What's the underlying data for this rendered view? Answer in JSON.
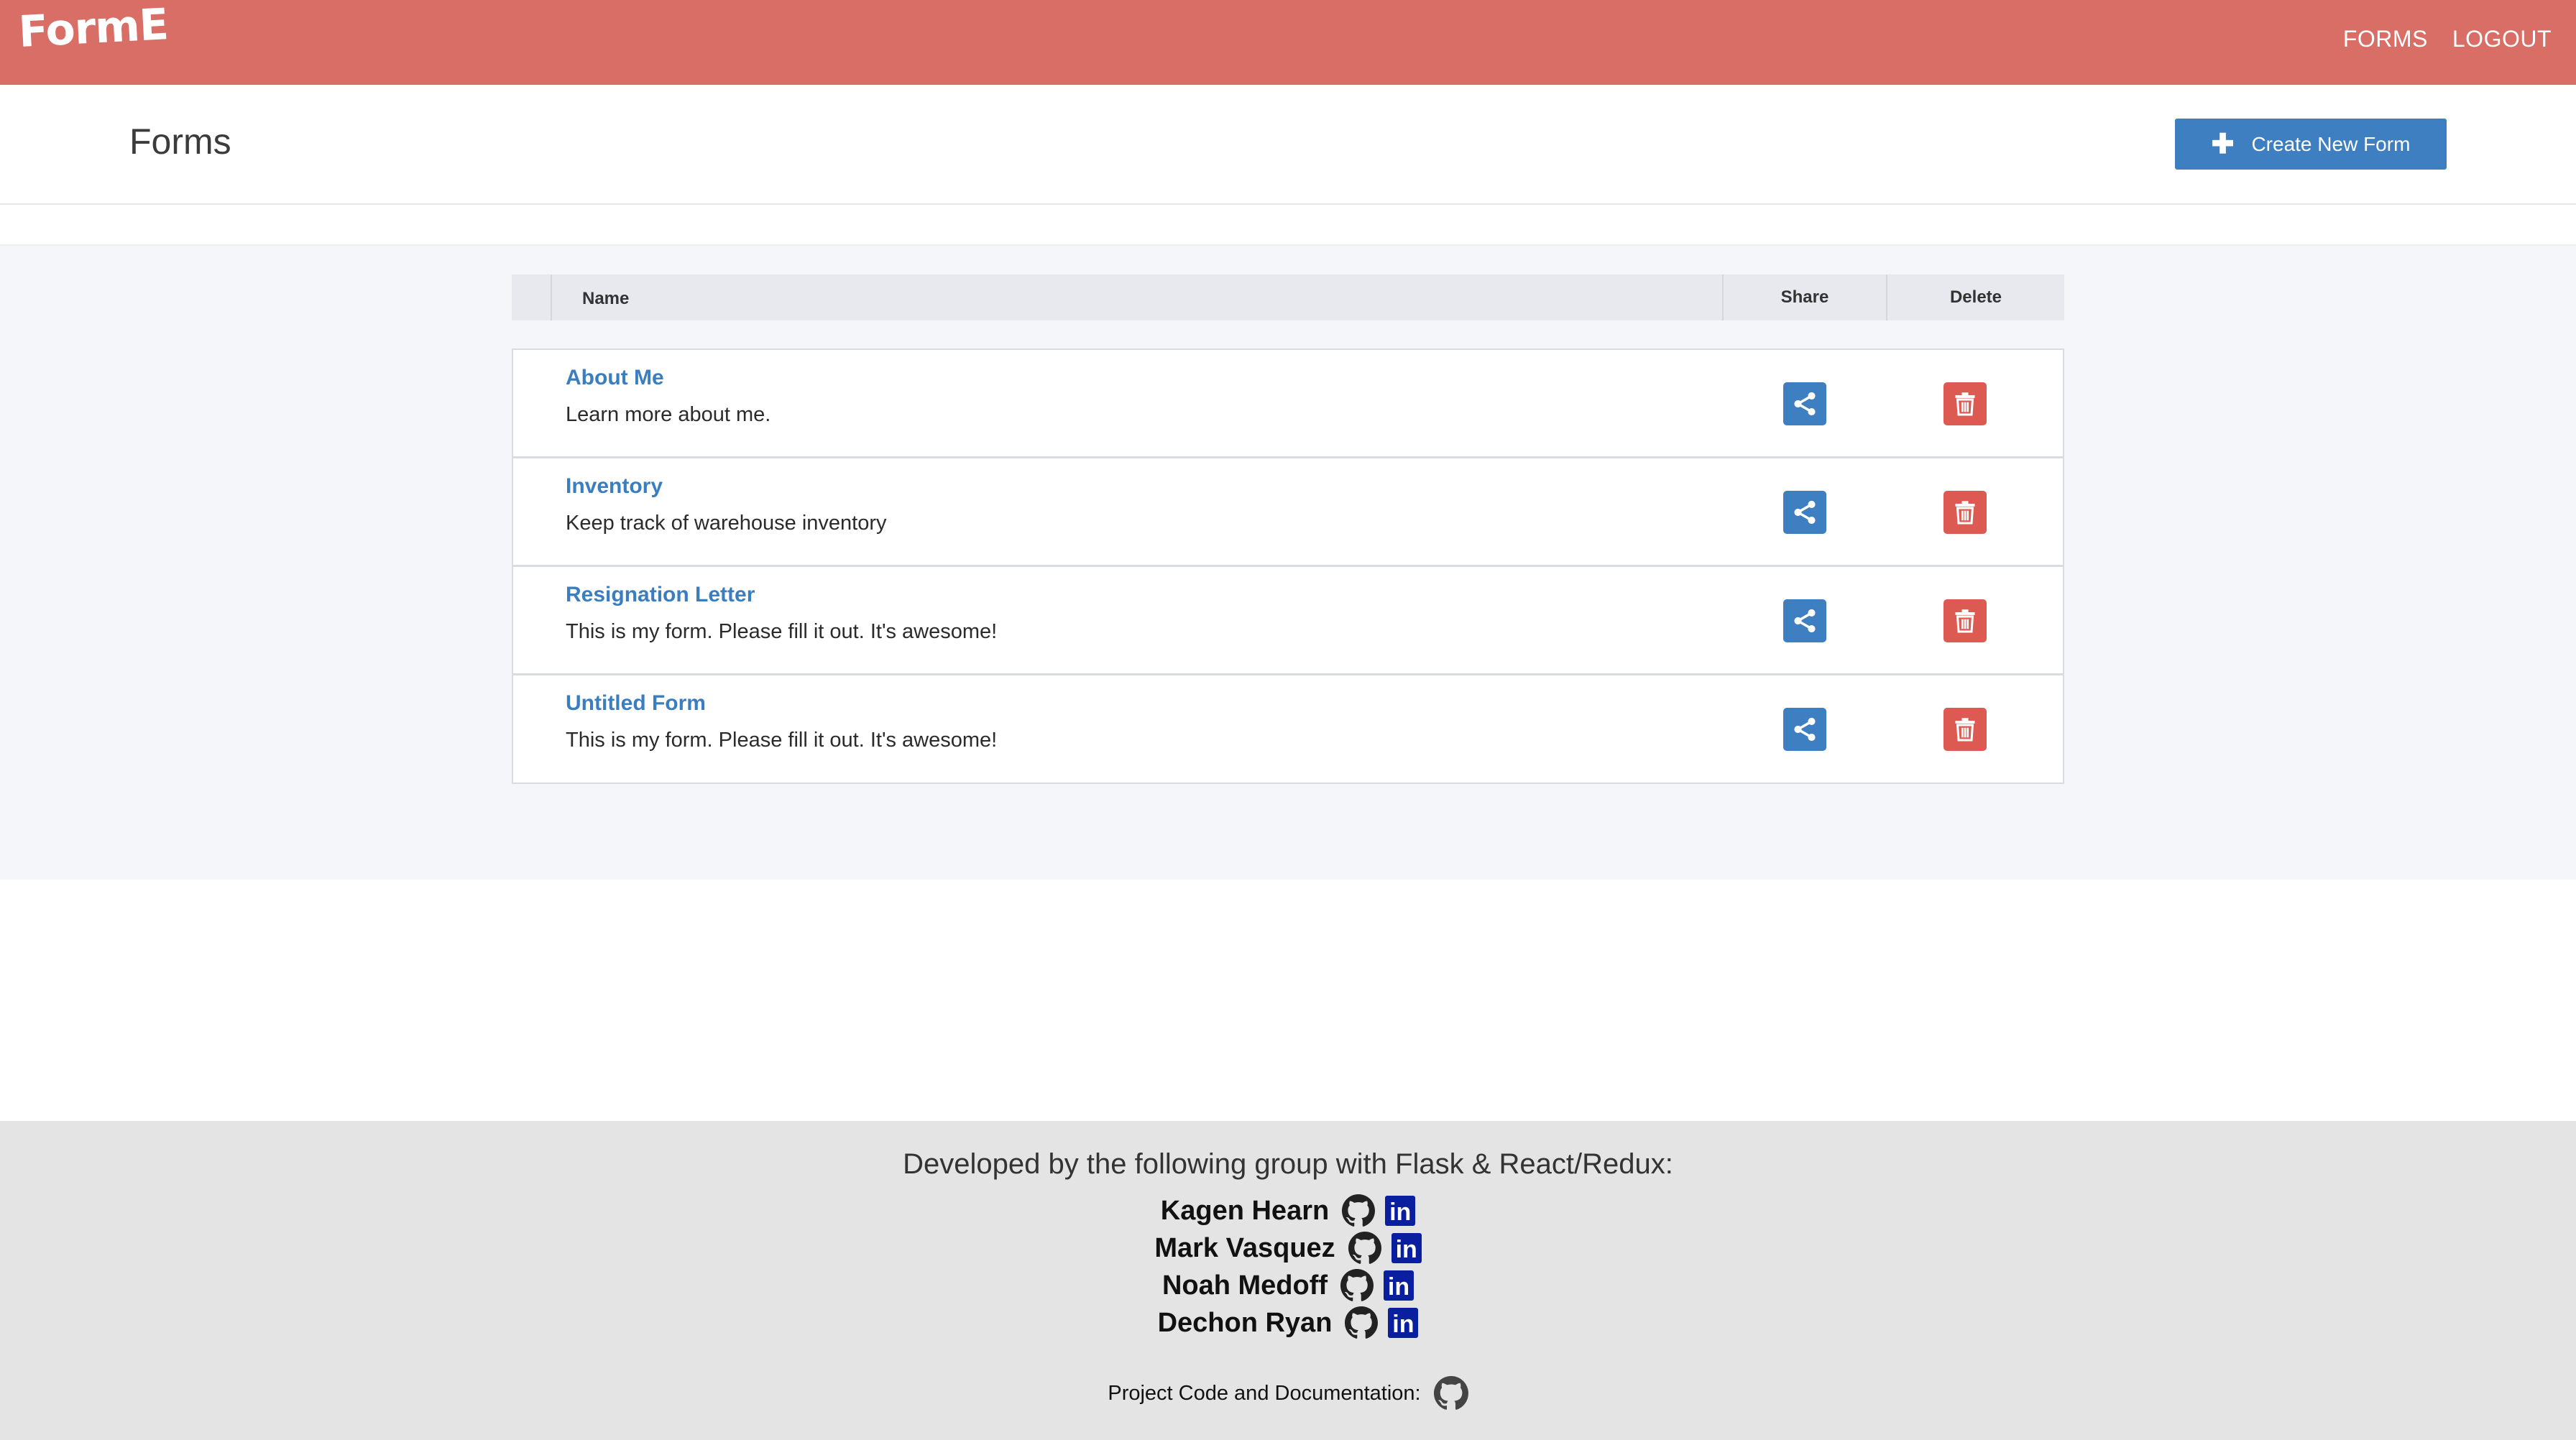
{
  "navbar": {
    "logo": "FormE",
    "links": [
      "FORMS",
      "LOGOUT"
    ]
  },
  "header": {
    "title": "Forms",
    "create_label": "Create New Form"
  },
  "table": {
    "columns": [
      "Name",
      "Share",
      "Delete"
    ],
    "rows": [
      {
        "name": "About Me",
        "description": "Learn more about me."
      },
      {
        "name": "Inventory",
        "description": "Keep track of warehouse inventory"
      },
      {
        "name": "Resignation Letter",
        "description": "This is my form. Please fill it out. It's awesome!"
      },
      {
        "name": "Untitled Form",
        "description": "This is my form. Please fill it out. It's awesome!"
      }
    ]
  },
  "footer": {
    "heading": "Developed by the following group with Flask & React/Redux:",
    "developers": [
      "Kagen Hearn",
      "Mark Vasquez",
      "Noah Medoff",
      "Dechon Ryan"
    ],
    "linkedin_glyph": "in",
    "project_label": "Project Code and Documentation:"
  },
  "colors": {
    "navbar": "#d96e66",
    "primary": "#3e7fc1",
    "danger": "#dd5a52",
    "linkedin": "#0a1ea0"
  },
  "icons": {
    "share": "share-icon",
    "delete": "trash-icon",
    "github": "github-icon",
    "linkedin": "linkedin-icon",
    "plus": "plus-icon"
  }
}
